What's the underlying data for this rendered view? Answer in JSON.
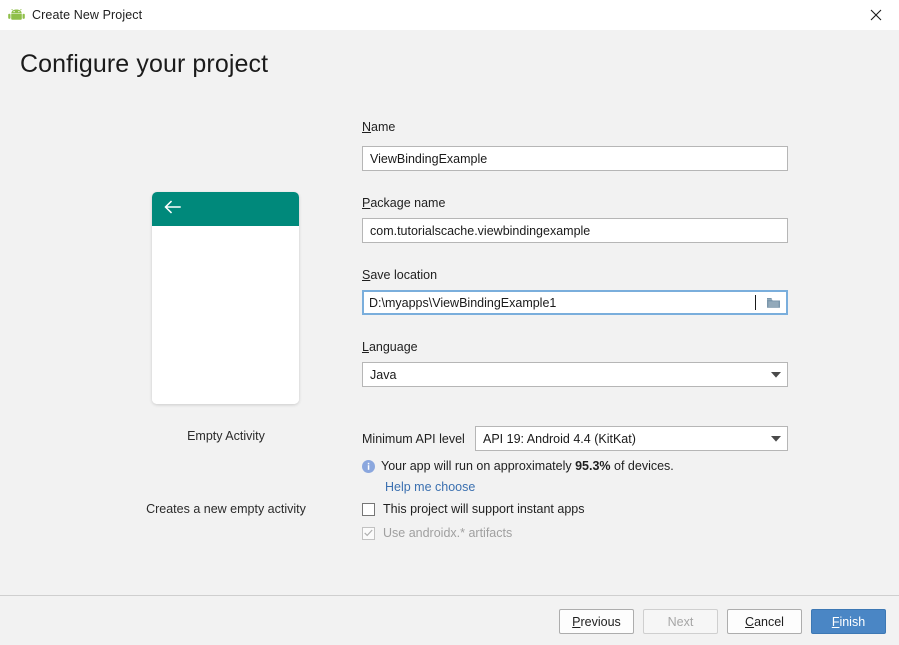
{
  "window": {
    "title": "Create New Project",
    "app_icon": "android-robot-icon",
    "close_icon": "close-icon"
  },
  "page": {
    "heading": "Configure your project"
  },
  "preview": {
    "back_icon": "back-arrow-icon",
    "appbar_color": "#00897b",
    "template_name": "Empty Activity",
    "template_description": "Creates a new empty activity"
  },
  "form": {
    "name": {
      "label": "Name",
      "mnemonic": "N",
      "rest": "ame",
      "value": "ViewBindingExample"
    },
    "package_name": {
      "label": "Package name",
      "mnemonic": "P",
      "rest": "ackage name",
      "value": "com.tutorialscache.viewbindingexample"
    },
    "save_location": {
      "label": "Save location",
      "mnemonic": "S",
      "rest": "ave location",
      "value": "D:\\myapps\\ViewBindingExample1",
      "browse_icon": "folder-icon",
      "focused": true
    },
    "language": {
      "label": "Language",
      "mnemonic": "L",
      "rest": "anguage",
      "value": "Java",
      "arrow_icon": "chevron-down-icon"
    },
    "minimum_api": {
      "label": "Minimum API level",
      "value": "API 19: Android 4.4 (KitKat)",
      "arrow_icon": "chevron-down-icon"
    },
    "api_info": {
      "icon": "info-icon",
      "text_before": "Your app will run on approximately ",
      "percent": "95.3%",
      "text_after": " of devices.",
      "help_link": "Help me choose"
    },
    "instant_apps": {
      "label": "This project will support instant apps",
      "checked": false,
      "enabled": true
    },
    "androidx": {
      "label": "Use androidx.* artifacts",
      "checked": true,
      "enabled": false,
      "check_icon": "checkmark-icon"
    }
  },
  "footer": {
    "previous": {
      "label": "Previous",
      "mnemonic": "P",
      "rest": "revious",
      "enabled": true
    },
    "next": {
      "label": "Next",
      "enabled": false
    },
    "cancel": {
      "label": "Cancel",
      "mnemonic": "C",
      "rest": "ancel",
      "enabled": true
    },
    "finish": {
      "label": "Finish",
      "mnemonic": "F",
      "rest": "inish",
      "enabled": true,
      "accent_color": "#4a86c5"
    }
  },
  "scrollbar": {
    "orientation": "vertical",
    "thumb_color": "#dadada"
  }
}
